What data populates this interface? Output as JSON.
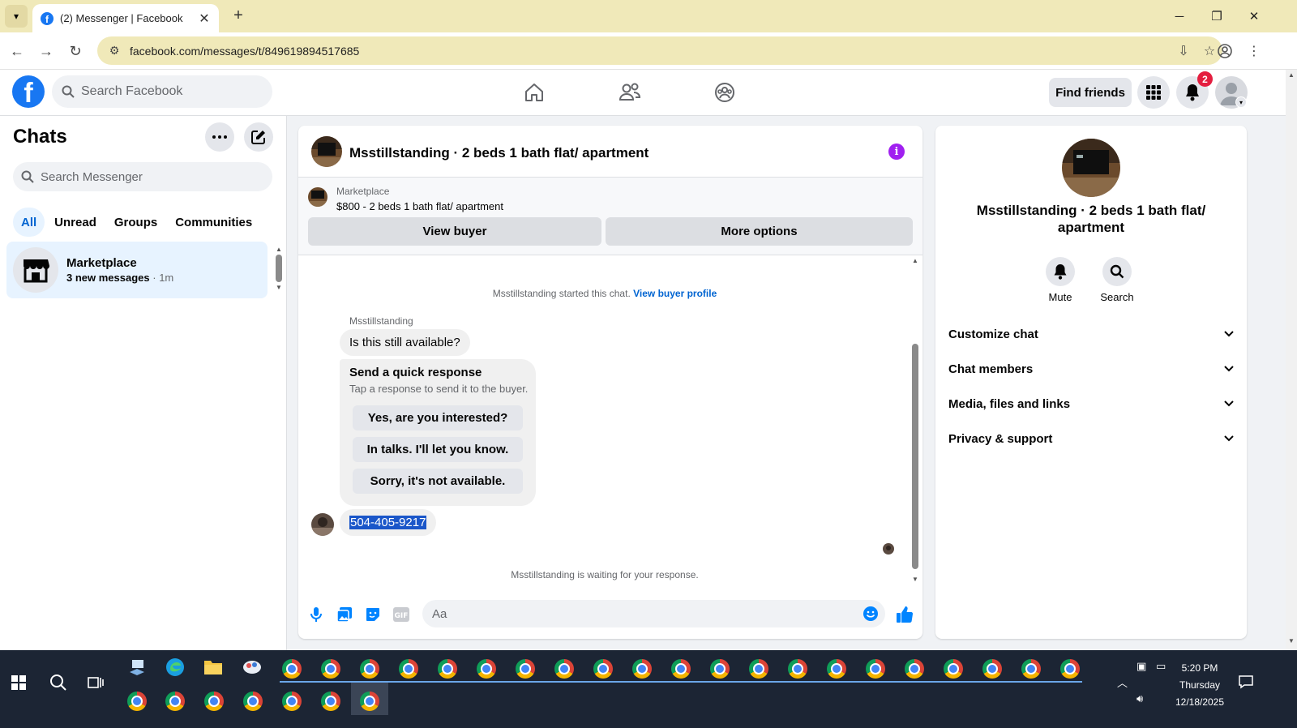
{
  "browser": {
    "tab_title": "(2) Messenger | Facebook",
    "url": "facebook.com/messages/t/849619894517685"
  },
  "fb_header": {
    "search_placeholder": "Search Facebook",
    "find_friends": "Find friends",
    "notification_count": "2"
  },
  "sidebar": {
    "title": "Chats",
    "search_placeholder": "Search Messenger",
    "filters": [
      "All",
      "Unread",
      "Groups",
      "Communities"
    ],
    "active_filter": "All",
    "chats": [
      {
        "name": "Marketplace",
        "new_messages": "3 new messages",
        "time": "1m"
      }
    ]
  },
  "conversation": {
    "title": "Msstillstanding · 2 beds 1 bath flat/ apartment",
    "marketplace_label": "Marketplace",
    "listing": "$800 - 2 beds 1 bath flat/ apartment",
    "view_buyer": "View buyer",
    "more_options": "More options",
    "started_text": "Msstillstanding started this chat.",
    "view_buyer_profile": "View buyer profile",
    "sender_name": "Msstillstanding",
    "message_1": "Is this still available?",
    "quick_title": "Send a quick response",
    "quick_sub": "Tap a response to send it to the buyer.",
    "quick_responses": [
      "Yes, are you interested?",
      "In talks. I'll let you know.",
      "Sorry, it's not available."
    ],
    "message_2": "504-405-9217",
    "waiting": "Msstillstanding is waiting for your response.",
    "composer_placeholder": "Aa"
  },
  "info_panel": {
    "name": "Msstillstanding · 2 beds 1 bath flat/ apartment",
    "actions": [
      "Mute",
      "Search"
    ],
    "sections": [
      "Customize chat",
      "Chat members",
      "Media, files and links",
      "Privacy & support"
    ]
  },
  "taskbar": {
    "time": "5:20 PM",
    "day": "Thursday",
    "date": "12/18/2025"
  },
  "colors": {
    "fb_blue": "#1877f2",
    "active_chat_bg": "#e7f3ff",
    "tabbar": "#f0e9b9",
    "selection": "#1a56c9"
  }
}
